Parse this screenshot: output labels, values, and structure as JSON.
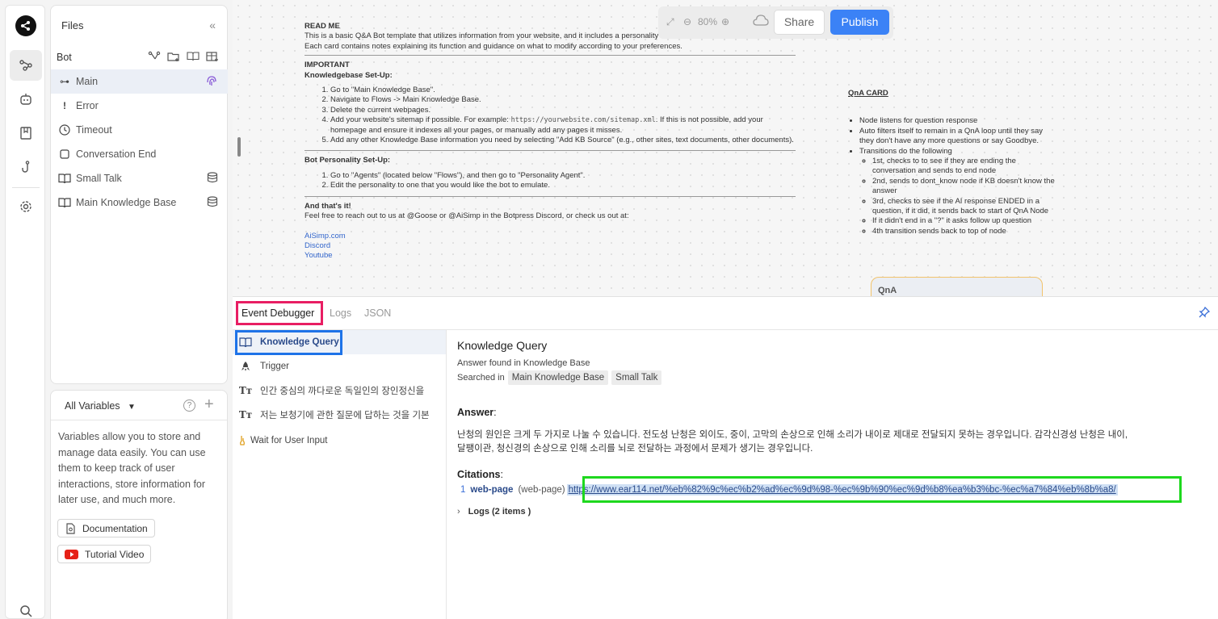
{
  "files_panel": {
    "title": "Files",
    "bot_label": "Bot",
    "items": [
      {
        "label": "Main",
        "icon": "main-flow-icon"
      },
      {
        "label": "Error",
        "icon": "exclamation-icon"
      },
      {
        "label": "Timeout",
        "icon": "clock-icon"
      },
      {
        "label": "Conversation End",
        "icon": "square-icon"
      },
      {
        "label": "Small Talk",
        "icon": "book-icon"
      },
      {
        "label": "Main Knowledge Base",
        "icon": "book-icon"
      }
    ]
  },
  "variables_panel": {
    "selector": "All Variables",
    "description": "Variables allow you to store and manage data easily. You can use them to keep track of user interactions, store information for later use, and much more.",
    "documentation_label": "Documentation",
    "tutorial_label": "Tutorial Video"
  },
  "toolbar": {
    "zoom": "80%",
    "share_label": "Share",
    "publish_label": "Publish"
  },
  "readme": {
    "title": "READ ME",
    "intro1": "This is a basic Q&A Bot template that utilizes information from your website, and it includes a personality for the bot to mimic.",
    "intro2": "Each card contains notes explaining its function and guidance on what to modify according to your preferences.",
    "important": "IMPORTANT",
    "kb_setup": "Knowledgebase Set-Up:",
    "kb_steps": [
      "Go to \"Main Knowledge Base\".",
      "Navigate to Flows -> Main Knowledge Base.",
      "Delete the current webpages."
    ],
    "kb_step4_a": "Add your website's sitemap if possible. For example: ",
    "kb_step4_mono": "https://yourwebsite.com/sitemap.xml",
    "kb_step4_b": ". If this is not possible, add your homepage and ensure it indexes all your pages, or manually add any pages it misses.",
    "kb_step5": "Add any other Knowledge Base information you need by selecting \"Add KB Source\" (e.g., other sites, text documents, other documents).",
    "personality_setup": "Bot Personality Set-Up:",
    "personality_steps": [
      "Go to \"Agents\" (located below \"Flows\"), and then go to \"Personality Agent\".",
      "Edit the personality to one that you would like the bot to emulate."
    ],
    "thats_it": "And that's it!",
    "reach_out": "Feel free to reach out to us at @Goose or @AiSimp in the Botpress Discord, or check us out at:",
    "links": [
      "AiSimp.com",
      "Discord",
      "Youtube"
    ]
  },
  "qna_card": {
    "title": "QnA CARD",
    "bullets": [
      "Node listens for question response",
      "Auto filters itself to remain in a QnA loop until they say they don't have any more questions or say Goodbye.",
      "Transitions do the following"
    ],
    "sub_bullets": [
      "1st, checks to to see if they are ending the conversation and sends to end node",
      "2nd, sends to dont_know node if KB doesn't know the answer",
      "3rd, checks to see if the AI response ENDED in a question, if it did, it sends back to start of QnA Node",
      "If it didn't end in a \"?\" it asks follow up question",
      "4th transition sends back to top of node"
    ],
    "node_label": "QnA"
  },
  "debugger": {
    "tabs": [
      "Event Debugger",
      "Logs",
      "JSON"
    ],
    "events": [
      {
        "label": "Knowledge Query",
        "icon": "book-icon"
      },
      {
        "label": "Trigger",
        "icon": "rocket-icon"
      },
      {
        "label": "인간 중심의 까다로운 독일인의 장인정신을",
        "icon": "text-icon"
      },
      {
        "label": "저는 보청기에 관한 질문에 답하는 것을 기본",
        "icon": "text-icon"
      },
      {
        "label": "Wait for User Input",
        "icon": "hand-icon"
      }
    ],
    "detail": {
      "title": "Knowledge Query",
      "subtitle": "Answer found in Knowledge Base",
      "searched_in_label": "Searched in",
      "sources": [
        "Main Knowledge Base",
        "Small Talk"
      ],
      "answer_label": "Answer",
      "answer_line1": "난청의 원인은 크게 두 가지로 나눌 수 있습니다. 전도성 난청은 외이도, 중이, 고막의 손상으로 인해 소리가 내이로 제대로 전달되지 못하는 경우입니다. 감각신경성 난청은 내이,",
      "answer_line2": "달팽이관, 청신경의 손상으로 인해 소리를 뇌로 전달하는 과정에서 문제가 생기는 경우입니다.",
      "citations_label": "Citations",
      "citation": {
        "number": "1",
        "source": "web-page",
        "type": "(web-page)",
        "url": "https://www.ear114.net/%eb%82%9c%ec%b2%ad%ec%9d%98-%ec%9b%90%ec%9d%b8%ea%b3%bc-%ec%a7%84%eb%8b%a8/"
      },
      "logs_label": "Logs (2 items )"
    }
  },
  "colors": {
    "accent": "#3b82f6",
    "highlight_red": "#e81e63",
    "highlight_blue": "#1e73e8",
    "highlight_green": "#1ed81e"
  }
}
